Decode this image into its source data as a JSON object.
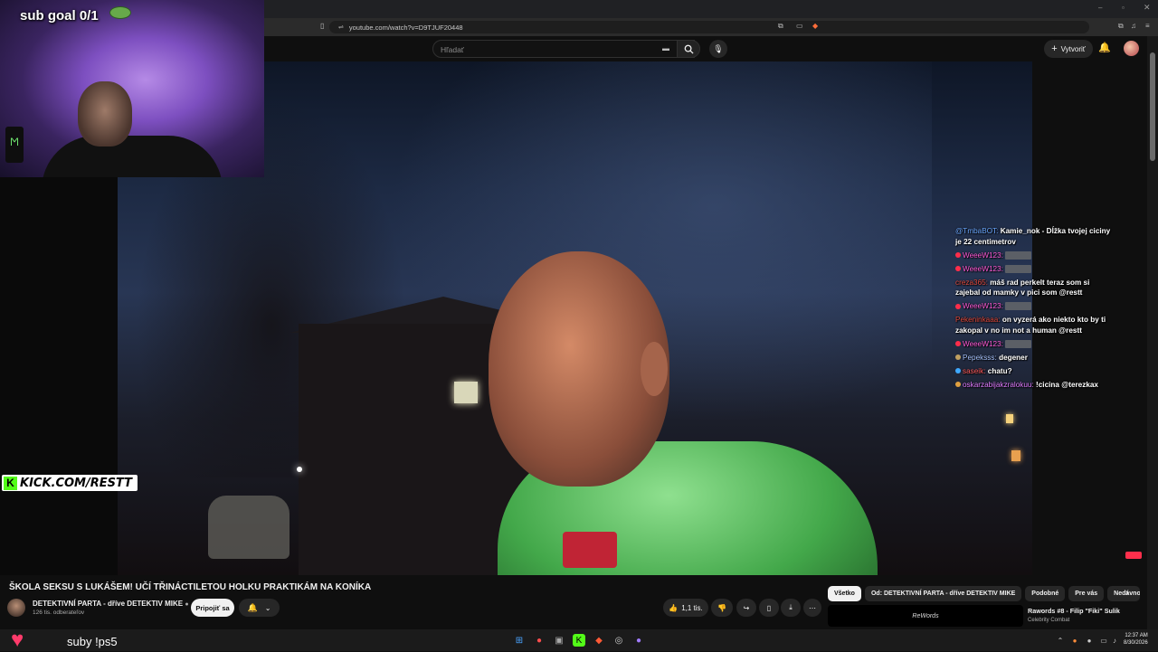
{
  "browser": {
    "url": "youtube.com/watch?v=D9TJUF20448"
  },
  "youtube": {
    "search_placeholder": "Hľadať",
    "create_label": "Vytvoriť",
    "video_title": "ŠKOLA SEKSU S LUKÁŠEM! UČÍ TŘINÁCTILETOU HOLKU PRAKTIKÁM NA KONÍKA",
    "channel_name": "DETEKTIVNÍ PARTA - dříve DETEKTIV MIKE",
    "subscribers": "126 tis. odberateľov",
    "join_label": "Pripojiť sa",
    "likes": "1,1 tis.",
    "chips": [
      "Všetko",
      "Od: DETEKTIVNÍ PARTA - dříve DETEKTIV MIKE",
      "Podobné",
      "Pre vás",
      "Nedávno"
    ],
    "rec_thumb_text": "ReWords",
    "rec_title": "Rawords #8 - Filip \"Fiki\" Sulik",
    "rec_channel": "Celebrity Combat"
  },
  "stream": {
    "sub_goal": "sub goal 0/1",
    "kick_text": "KICK.COM/RESTT",
    "kick_letter": "K",
    "bottom_text": "suby !ps5"
  },
  "chat": [
    {
      "user": "@TmbaBOT:",
      "user_color": "#6aa7ff",
      "text": "Kamie_nok - Dĺžka tvojej ciciny je 22 centimetrov",
      "badge": ""
    },
    {
      "user": "WeeeW123:",
      "user_color": "#ff59d6",
      "text": "",
      "badge": "#ff2d4a",
      "placeholder": true
    },
    {
      "user": "WeeeW123:",
      "user_color": "#ff59d6",
      "text": "",
      "badge": "#ff2d4a",
      "placeholder": true
    },
    {
      "user": "creza365:",
      "user_color": "#e0483c",
      "text": "máš rad perkelt teraz som si zajebal od mamky v pici som @restt",
      "badge": ""
    },
    {
      "user": "WeeeW123:",
      "user_color": "#ff59d6",
      "text": "",
      "badge": "#ff2d4a",
      "placeholder": true
    },
    {
      "user": "Pekeninkaaa:",
      "user_color": "#e0483c",
      "text": "on vyzerá ako niekto kto by ti zakopal v no im not a human @restt",
      "badge": ""
    },
    {
      "user": "WeeeW123:",
      "user_color": "#ff59d6",
      "text": "",
      "badge": "#ff2d4a",
      "placeholder": true
    },
    {
      "user": "Pepeksss:",
      "user_color": "#a8c4ff",
      "text": "degener",
      "badge": "#c0a060"
    },
    {
      "user": "saseik:",
      "user_color": "#ff5b5b",
      "text": "chatu?",
      "badge": "#3fa9ff"
    },
    {
      "user": "oskarzabijakzralokuu:",
      "user_color": "#e07cff",
      "text": "!cicina @terezkax",
      "badge": "#e0a040"
    }
  ],
  "taskbar": {
    "time": "12:37 AM",
    "date": "8/30/2026"
  },
  "colors": {
    "kick_green": "#53fc18",
    "yt_bg": "#0f0f0f",
    "heart": "#ff3b6b"
  }
}
